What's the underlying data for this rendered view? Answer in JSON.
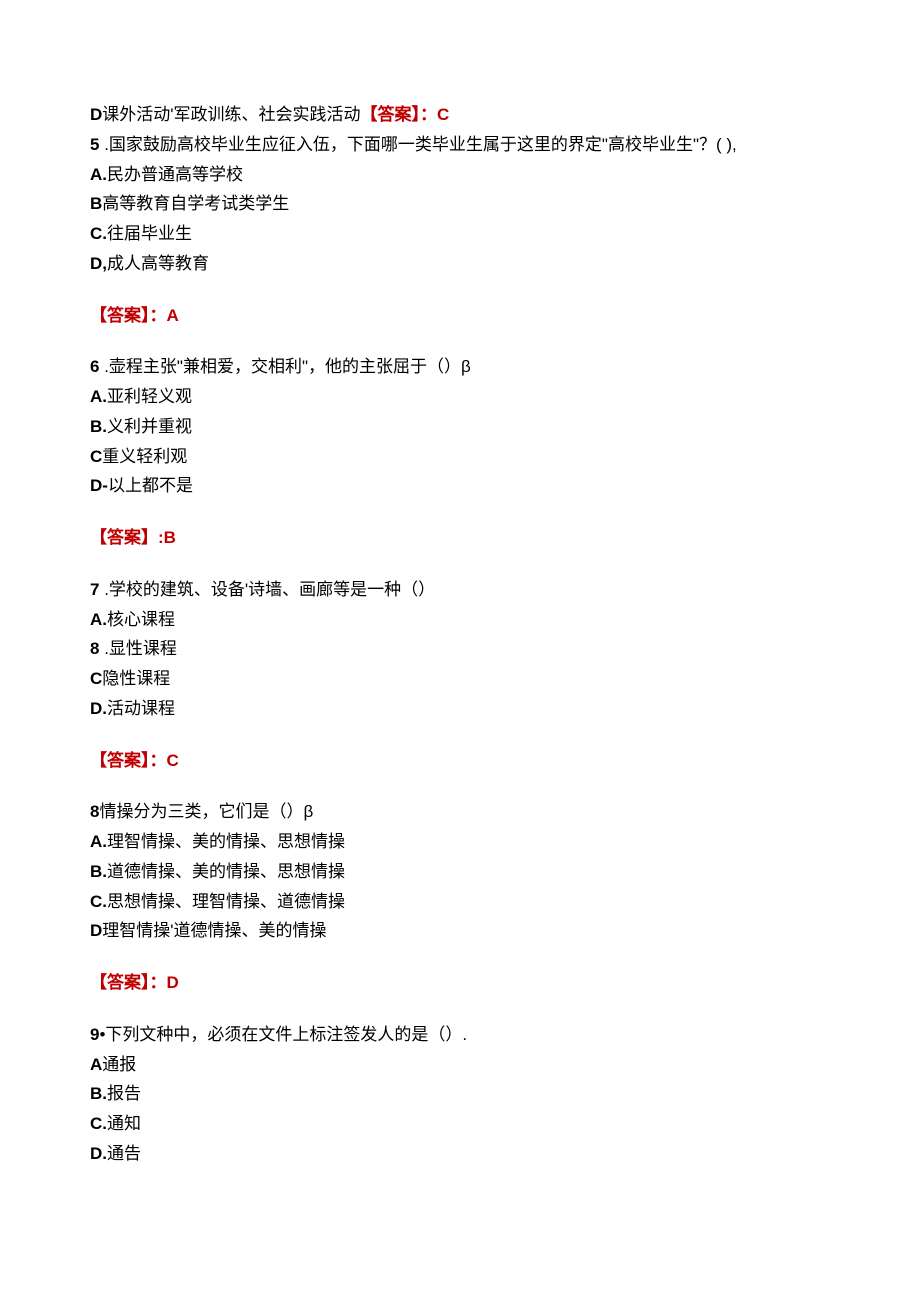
{
  "lines": {
    "l1_d": "D",
    "l1_text": "课外活动'军政训练、社会实践活动",
    "l1_ans": "【答案】：C",
    "q5_num": "5",
    "q5_text": "  .国家鼓励高校毕业生应征入伍，下面哪一类毕业生属于这里的界定\"高校毕业生\"？( ),",
    "q5_a": "A.",
    "q5_a_text": "民办普通高等学校",
    "q5_b": "B",
    "q5_b_text": "高等教育自学考试类学生",
    "q5_c": "C.",
    "q5_c_text": "往届毕业生",
    "q5_d": "D,",
    "q5_d_text": "成人高等教育",
    "q5_ans": "【答案】：A",
    "q6_num": "6",
    "q6_text": "  .壶程主张\"兼相爱，交相利\"，他的主张屈于（）β",
    "q6_a": "A.",
    "q6_a_text": "亚利轻义观",
    "q6_b": "B.",
    "q6_b_text": "义利并重视",
    "q6_c": "C",
    "q6_c_text": "重义轻利观",
    "q6_d": "D-",
    "q6_d_text": "以上都不是",
    "q6_ans": "【答案】:B",
    "q7_num": "7",
    "q7_text": "   .学校的建筑、设备'诗墙、画廊等是一种（）",
    "q7_a": "A.",
    "q7_a_text": "核心课程",
    "q7_b_num": "8",
    "q7_b_text": "   .显性课程",
    "q7_c": "C",
    "q7_c_text": "隐性课程",
    "q7_d": "D.",
    "q7_d_text": "活动课程",
    "q7_ans": "【答案】：C",
    "q8_num": "8",
    "q8_text": "情操分为三类，它们是（）β",
    "q8_a": "A.",
    "q8_a_text": "理智情操、美的情操、思想情操",
    "q8_b": "B.",
    "q8_b_text": "道德情操、美的情操、思想情操",
    "q8_c": "C.",
    "q8_c_text": "思想情操、理智情操、道德情操",
    "q8_d": "D",
    "q8_d_text": "理智情操'道德情操、美的情操",
    "q8_ans": "【答案】：D",
    "q9_num": "9",
    "q9_text": "•下列文种中，必须在文件上标注签发人的是（）.",
    "q9_a": "A",
    "q9_a_text": "通报",
    "q9_b": "B.",
    "q9_b_text": "报告",
    "q9_c": "C.",
    "q9_c_text": "通知",
    "q9_d": "D.",
    "q9_d_text": "通告"
  }
}
